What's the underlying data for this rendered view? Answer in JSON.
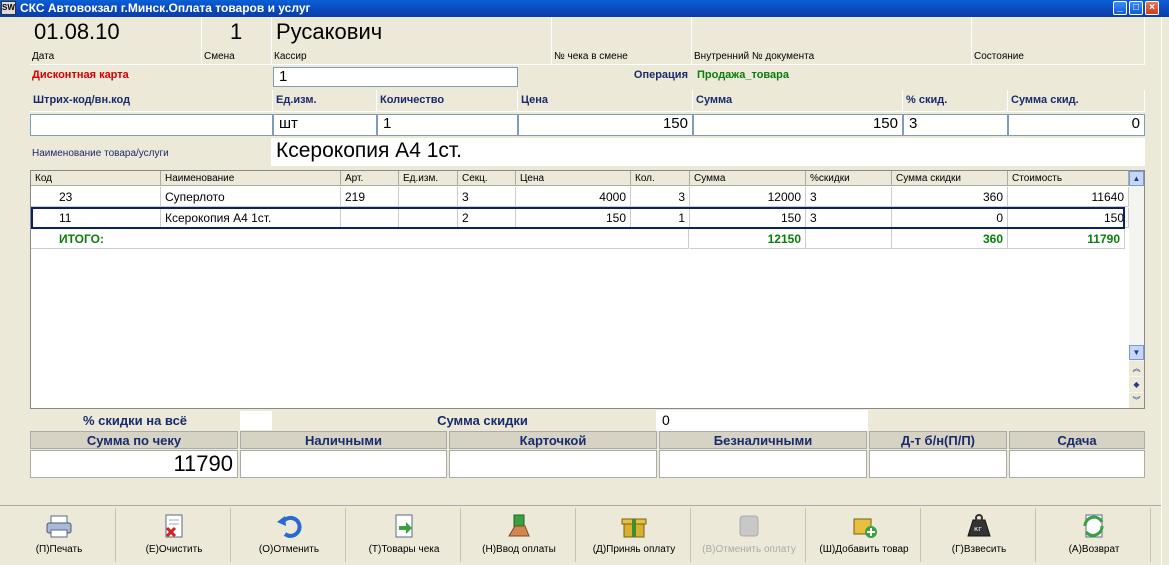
{
  "window": {
    "app_icon": "SW",
    "title": "СКС Автовокзал г.Минск.Оплата товаров и услуг",
    "controls": [
      "minimize-icon",
      "maximize-icon",
      "close-icon"
    ]
  },
  "header": {
    "date_value": "01.08.10",
    "date_label": "Дата",
    "shift_value": "1",
    "shift_label": "Смена",
    "cashier_value": "Русакович",
    "cashier_label": "Кассир",
    "receipt_no_label": "№ чека в смене",
    "internal_doc_label": "Внутренний № документа",
    "state_label": "Состояние"
  },
  "discount_card": {
    "label": "Дисконтная карта",
    "value": "1"
  },
  "operation": {
    "label": "Операция",
    "value": "Продажа_товара"
  },
  "entry": {
    "headers": {
      "barcode": "Штрих-код/вн.код",
      "unit": "Ед.изм.",
      "quantity": "Количество",
      "price": "Цена",
      "sum": "Сумма",
      "discount_pct": "% скид.",
      "discount_sum": "Сумма скид."
    },
    "values": {
      "barcode": "",
      "unit": "шт",
      "quantity": "1",
      "price": "150",
      "sum": "150",
      "discount_pct": "3",
      "discount_sum": "0"
    },
    "name_label": "Наименование товара/услуги",
    "name_value": "Ксерокопия А4 1ст."
  },
  "grid": {
    "columns": [
      "Код",
      "Наименование",
      "Арт.",
      "Ед.изм.",
      "Секц.",
      "Цена",
      "Кол.",
      "Сумма",
      "%скидки",
      "Сумма скидки",
      "Стоимость"
    ],
    "rows": [
      [
        "23",
        "Суперлото",
        "219",
        "",
        "3",
        "4000",
        "3",
        "12000",
        "3",
        "360",
        "11640"
      ],
      [
        "11",
        "Ксерокопия А4 1ст.",
        "",
        "",
        "2",
        "150",
        "1",
        "150",
        "3",
        "0",
        "150"
      ]
    ],
    "total": {
      "label": "ИТОГО:",
      "sum": "12150",
      "discount_sum": "360",
      "cost": "11790"
    },
    "selected_row": 1
  },
  "summary": {
    "discount_all_label": "% скидки на всё",
    "discount_all_value": "",
    "discount_sum_label": "Сумма скидки",
    "discount_sum_value": "0",
    "labels": {
      "receipt_sum": "Сумма по чеку",
      "cash": "Наличными",
      "card": "Карточкой",
      "cashless": "Безналичными",
      "dt": "Д-т б/н(П/П)",
      "change": "Сдача"
    },
    "values": {
      "receipt_sum": "11790",
      "cash": "",
      "card": "",
      "cashless": "",
      "dt": "",
      "change": ""
    }
  },
  "toolbar": {
    "buttons": [
      {
        "label": "(П)Печать",
        "icon": "printer-icon",
        "enabled": true
      },
      {
        "label": "(Е)Очистить",
        "icon": "clear-document-icon",
        "enabled": true
      },
      {
        "label": "(О)Отменить",
        "icon": "undo-icon",
        "enabled": true
      },
      {
        "label": "(Т)Товары чека",
        "icon": "receipt-items-icon",
        "enabled": true
      },
      {
        "label": "(Н)Ввод оплаты",
        "icon": "payment-hand-icon",
        "enabled": true
      },
      {
        "label": "(Д)Приняь оплату",
        "icon": "gift-box-icon",
        "enabled": true
      },
      {
        "label": "(В)Отменить оплату",
        "icon": "cancel-payment-icon",
        "enabled": false
      },
      {
        "label": "(Ш)Добавить товар",
        "icon": "add-item-icon",
        "enabled": true
      },
      {
        "label": "(Г)Взвесить",
        "icon": "weight-icon",
        "enabled": true
      },
      {
        "label": "(А)Возврат",
        "icon": "return-icon",
        "enabled": true
      }
    ]
  },
  "colors": {
    "title_bar": "#0b47b8",
    "header_text": "#1a2a6c",
    "discount_card_label": "#d40000",
    "operation_value": "#0a7d0a",
    "selected_row_border": "#0b1f6b"
  }
}
